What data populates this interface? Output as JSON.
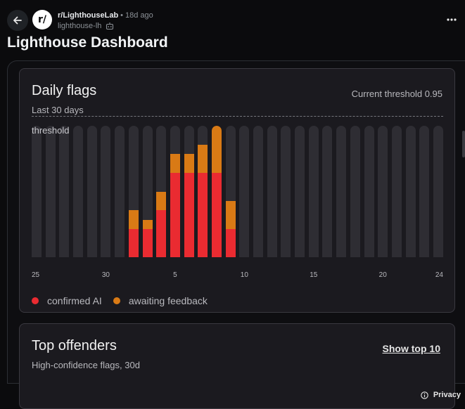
{
  "post": {
    "subreddit": "r/LighthouseLab",
    "separator": "•",
    "age": "18d ago",
    "author": "lighthouse-lh",
    "title": "Lighthouse Dashboard"
  },
  "daily_flags": {
    "title": "Daily flags",
    "subtitle": "Last 30 days",
    "threshold_text": "Current threshold 0.95",
    "threshold_label": "threshold",
    "legend": [
      {
        "label": "confirmed AI",
        "color": "#ea2b31"
      },
      {
        "label": "awaiting feedback",
        "color": "#d97a15"
      }
    ]
  },
  "chart_data": {
    "type": "bar",
    "stacked": true,
    "x_tick_labels": [
      "25",
      "30",
      "5",
      "10",
      "15",
      "20",
      "24"
    ],
    "x_tick_indices": [
      0,
      5,
      10,
      15,
      20,
      25,
      30
    ],
    "day_count": 30,
    "series": [
      {
        "name": "confirmed AI",
        "color": "#ea2b31",
        "values": [
          0,
          0,
          0,
          0,
          0,
          0,
          0,
          3,
          3,
          5,
          9,
          9,
          9,
          9,
          3,
          0,
          0,
          0,
          0,
          0,
          0,
          0,
          0,
          0,
          0,
          0,
          0,
          0,
          0,
          0
        ]
      },
      {
        "name": "awaiting feedback",
        "color": "#d97a15",
        "values": [
          0,
          0,
          0,
          0,
          0,
          0,
          0,
          2,
          1,
          2,
          2,
          2,
          3,
          5,
          3,
          0,
          0,
          0,
          0,
          0,
          0,
          0,
          0,
          0,
          0,
          0,
          0,
          0,
          0,
          0
        ]
      }
    ],
    "ylim": [
      0,
      14
    ]
  },
  "top_offenders": {
    "title": "Top offenders",
    "subtitle": "High-confidence flags, 30d",
    "button_label": "Show top 10"
  },
  "footer": {
    "privacy_label": "Privacy"
  }
}
